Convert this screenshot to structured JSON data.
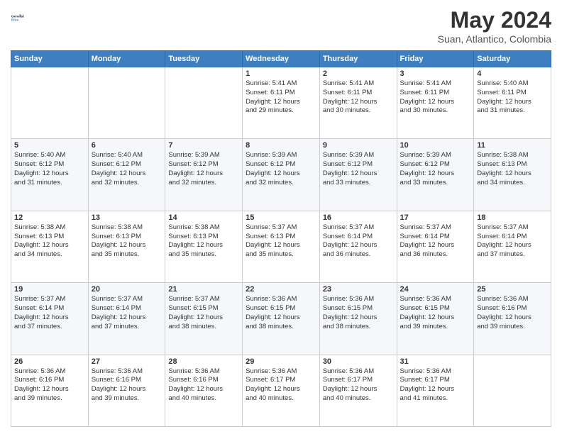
{
  "logo": {
    "line1": "General",
    "line2": "Blue"
  },
  "title": "May 2024",
  "subtitle": "Suan, Atlantico, Colombia",
  "days_header": [
    "Sunday",
    "Monday",
    "Tuesday",
    "Wednesday",
    "Thursday",
    "Friday",
    "Saturday"
  ],
  "weeks": [
    [
      {
        "day": "",
        "info": ""
      },
      {
        "day": "",
        "info": ""
      },
      {
        "day": "",
        "info": ""
      },
      {
        "day": "1",
        "info": "Sunrise: 5:41 AM\nSunset: 6:11 PM\nDaylight: 12 hours\nand 29 minutes."
      },
      {
        "day": "2",
        "info": "Sunrise: 5:41 AM\nSunset: 6:11 PM\nDaylight: 12 hours\nand 30 minutes."
      },
      {
        "day": "3",
        "info": "Sunrise: 5:41 AM\nSunset: 6:11 PM\nDaylight: 12 hours\nand 30 minutes."
      },
      {
        "day": "4",
        "info": "Sunrise: 5:40 AM\nSunset: 6:11 PM\nDaylight: 12 hours\nand 31 minutes."
      }
    ],
    [
      {
        "day": "5",
        "info": "Sunrise: 5:40 AM\nSunset: 6:12 PM\nDaylight: 12 hours\nand 31 minutes."
      },
      {
        "day": "6",
        "info": "Sunrise: 5:40 AM\nSunset: 6:12 PM\nDaylight: 12 hours\nand 32 minutes."
      },
      {
        "day": "7",
        "info": "Sunrise: 5:39 AM\nSunset: 6:12 PM\nDaylight: 12 hours\nand 32 minutes."
      },
      {
        "day": "8",
        "info": "Sunrise: 5:39 AM\nSunset: 6:12 PM\nDaylight: 12 hours\nand 32 minutes."
      },
      {
        "day": "9",
        "info": "Sunrise: 5:39 AM\nSunset: 6:12 PM\nDaylight: 12 hours\nand 33 minutes."
      },
      {
        "day": "10",
        "info": "Sunrise: 5:39 AM\nSunset: 6:12 PM\nDaylight: 12 hours\nand 33 minutes."
      },
      {
        "day": "11",
        "info": "Sunrise: 5:38 AM\nSunset: 6:13 PM\nDaylight: 12 hours\nand 34 minutes."
      }
    ],
    [
      {
        "day": "12",
        "info": "Sunrise: 5:38 AM\nSunset: 6:13 PM\nDaylight: 12 hours\nand 34 minutes."
      },
      {
        "day": "13",
        "info": "Sunrise: 5:38 AM\nSunset: 6:13 PM\nDaylight: 12 hours\nand 35 minutes."
      },
      {
        "day": "14",
        "info": "Sunrise: 5:38 AM\nSunset: 6:13 PM\nDaylight: 12 hours\nand 35 minutes."
      },
      {
        "day": "15",
        "info": "Sunrise: 5:37 AM\nSunset: 6:13 PM\nDaylight: 12 hours\nand 35 minutes."
      },
      {
        "day": "16",
        "info": "Sunrise: 5:37 AM\nSunset: 6:14 PM\nDaylight: 12 hours\nand 36 minutes."
      },
      {
        "day": "17",
        "info": "Sunrise: 5:37 AM\nSunset: 6:14 PM\nDaylight: 12 hours\nand 36 minutes."
      },
      {
        "day": "18",
        "info": "Sunrise: 5:37 AM\nSunset: 6:14 PM\nDaylight: 12 hours\nand 37 minutes."
      }
    ],
    [
      {
        "day": "19",
        "info": "Sunrise: 5:37 AM\nSunset: 6:14 PM\nDaylight: 12 hours\nand 37 minutes."
      },
      {
        "day": "20",
        "info": "Sunrise: 5:37 AM\nSunset: 6:14 PM\nDaylight: 12 hours\nand 37 minutes."
      },
      {
        "day": "21",
        "info": "Sunrise: 5:37 AM\nSunset: 6:15 PM\nDaylight: 12 hours\nand 38 minutes."
      },
      {
        "day": "22",
        "info": "Sunrise: 5:36 AM\nSunset: 6:15 PM\nDaylight: 12 hours\nand 38 minutes."
      },
      {
        "day": "23",
        "info": "Sunrise: 5:36 AM\nSunset: 6:15 PM\nDaylight: 12 hours\nand 38 minutes."
      },
      {
        "day": "24",
        "info": "Sunrise: 5:36 AM\nSunset: 6:15 PM\nDaylight: 12 hours\nand 39 minutes."
      },
      {
        "day": "25",
        "info": "Sunrise: 5:36 AM\nSunset: 6:16 PM\nDaylight: 12 hours\nand 39 minutes."
      }
    ],
    [
      {
        "day": "26",
        "info": "Sunrise: 5:36 AM\nSunset: 6:16 PM\nDaylight: 12 hours\nand 39 minutes."
      },
      {
        "day": "27",
        "info": "Sunrise: 5:36 AM\nSunset: 6:16 PM\nDaylight: 12 hours\nand 39 minutes."
      },
      {
        "day": "28",
        "info": "Sunrise: 5:36 AM\nSunset: 6:16 PM\nDaylight: 12 hours\nand 40 minutes."
      },
      {
        "day": "29",
        "info": "Sunrise: 5:36 AM\nSunset: 6:17 PM\nDaylight: 12 hours\nand 40 minutes."
      },
      {
        "day": "30",
        "info": "Sunrise: 5:36 AM\nSunset: 6:17 PM\nDaylight: 12 hours\nand 40 minutes."
      },
      {
        "day": "31",
        "info": "Sunrise: 5:36 AM\nSunset: 6:17 PM\nDaylight: 12 hours\nand 41 minutes."
      },
      {
        "day": "",
        "info": ""
      }
    ]
  ]
}
